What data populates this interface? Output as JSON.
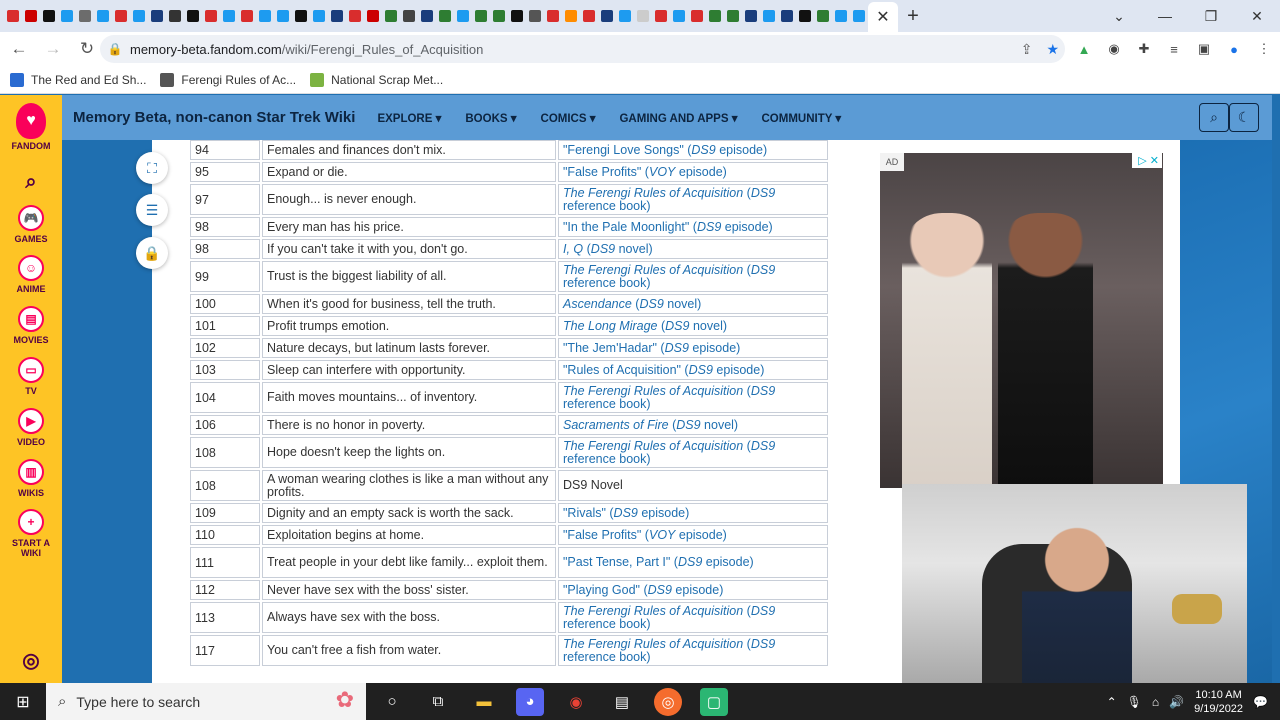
{
  "browser": {
    "tab_favicon_colors": [
      "#d92d2d",
      "#cc0000",
      "#111111",
      "#1d9bf0",
      "#6c6c6c",
      "#1d9bf0",
      "#d92d2d",
      "#1d9bf0",
      "#1a3d7c",
      "#333333",
      "#111111",
      "#d92d2d",
      "#1d9bf0",
      "#d92d2d",
      "#1d9bf0",
      "#1d9bf0",
      "#111111",
      "#1d9bf0",
      "#1a3d7c",
      "#d92d2d",
      "#cc0000",
      "#2e7d32",
      "#444444",
      "#1a3d7c",
      "#2e7d32",
      "#1d9bf0",
      "#2e7d32",
      "#2e7d32",
      "#111111",
      "#555555",
      "#d92d2d",
      "#ff8c00",
      "#d92d2d",
      "#1a3d7c",
      "#1d9bf0",
      "#cccccc",
      "#d92d2d",
      "#1d9bf0",
      "#d92d2d",
      "#2e7d32",
      "#2e7d32",
      "#1a3d7c",
      "#1d9bf0",
      "#1a3d7c",
      "#111111",
      "#2e7d32",
      "#1d9bf0",
      "#1d9bf0"
    ],
    "active_tab_close": "✕",
    "new_tab": "+",
    "url_host": "memory-beta.fandom.com",
    "url_path": "/wiki/Ferengi_Rules_of_Acquisition"
  },
  "bookmarks": [
    {
      "label": "The Red and Ed Sh...",
      "color": "#2a6bd1"
    },
    {
      "label": "Ferengi Rules of Ac...",
      "color": "#555555"
    },
    {
      "label": "National Scrap Met...",
      "color": "#7cb342"
    }
  ],
  "fandom_sidebar": {
    "brand": "FANDOM",
    "items": [
      {
        "label": "GAMES"
      },
      {
        "label": "ANIME"
      },
      {
        "label": "MOVIES"
      },
      {
        "label": "TV"
      },
      {
        "label": "VIDEO"
      },
      {
        "label": "WIKIS"
      },
      {
        "label": "START A WIKI"
      }
    ]
  },
  "wiki": {
    "title": "Memory Beta, non-canon Star Trek Wiki",
    "nav": [
      "EXPLORE ▾",
      "BOOKS ▾",
      "COMICS ▾",
      "GAMING AND APPS ▾",
      "COMMUNITY ▾"
    ]
  },
  "rules": [
    {
      "num": "94",
      "rule": "Females and finances don't mix.",
      "src": [
        {
          "t": "\"Ferengi Love Songs\" (",
          "i": false
        },
        {
          "t": "DS9",
          "i": true
        },
        {
          "t": " episode)",
          "i": false
        }
      ]
    },
    {
      "num": "95",
      "rule": "Expand or die.",
      "src": [
        {
          "t": "\"False Profits\" (",
          "i": false
        },
        {
          "t": "VOY",
          "i": true
        },
        {
          "t": " episode)",
          "i": false
        }
      ]
    },
    {
      "num": "97",
      "rule": "Enough... is never enough.",
      "tall": true,
      "src": [
        {
          "t": "The Ferengi Rules of Acquisition",
          "i": true
        },
        {
          "t": " (",
          "i": false
        },
        {
          "t": "DS9",
          "i": true
        },
        {
          "t": " reference book)",
          "i": false
        }
      ]
    },
    {
      "num": "98",
      "rule": "Every man has his price.",
      "src": [
        {
          "t": "\"In the Pale Moonlight\" (",
          "i": false
        },
        {
          "t": "DS9",
          "i": true
        },
        {
          "t": " episode)",
          "i": false
        }
      ]
    },
    {
      "num": "98",
      "rule": "If you can't take it with you, don't go.",
      "src": [
        {
          "t": "I, Q",
          "i": true
        },
        {
          "t": " (",
          "i": false
        },
        {
          "t": "DS9",
          "i": true
        },
        {
          "t": " novel)",
          "i": false
        }
      ]
    },
    {
      "num": "99",
      "rule": "Trust is the biggest liability of all.",
      "tall": true,
      "src": [
        {
          "t": "The Ferengi Rules of Acquisition",
          "i": true
        },
        {
          "t": " (",
          "i": false
        },
        {
          "t": "DS9",
          "i": true
        },
        {
          "t": " reference book)",
          "i": false
        }
      ]
    },
    {
      "num": "100",
      "rule": "When it's good for business, tell the truth.",
      "src": [
        {
          "t": "Ascendance",
          "i": true
        },
        {
          "t": " (",
          "i": false
        },
        {
          "t": "DS9",
          "i": true
        },
        {
          "t": " novel)",
          "i": false
        }
      ]
    },
    {
      "num": "101",
      "rule": "Profit trumps emotion.",
      "src": [
        {
          "t": "The Long Mirage",
          "i": true
        },
        {
          "t": " (",
          "i": false
        },
        {
          "t": "DS9",
          "i": true
        },
        {
          "t": " novel)",
          "i": false
        }
      ]
    },
    {
      "num": "102",
      "rule": "Nature decays, but latinum lasts forever.",
      "src": [
        {
          "t": "\"The Jem'Hadar\" (",
          "i": false
        },
        {
          "t": "DS9",
          "i": true
        },
        {
          "t": " episode)",
          "i": false
        }
      ]
    },
    {
      "num": "103",
      "rule": "Sleep can interfere with opportunity.",
      "src": [
        {
          "t": "\"Rules of Acquisition\" (",
          "i": false
        },
        {
          "t": "DS9",
          "i": true
        },
        {
          "t": " episode)",
          "i": false
        }
      ]
    },
    {
      "num": "104",
      "rule": "Faith moves mountains... of inventory.",
      "tall": true,
      "src": [
        {
          "t": "The Ferengi Rules of Acquisition",
          "i": true
        },
        {
          "t": " (",
          "i": false
        },
        {
          "t": "DS9",
          "i": true
        },
        {
          "t": " reference book)",
          "i": false
        }
      ]
    },
    {
      "num": "106",
      "rule": "There is no honor in poverty.",
      "src": [
        {
          "t": "Sacraments of Fire",
          "i": true
        },
        {
          "t": " (",
          "i": false
        },
        {
          "t": "DS9",
          "i": true
        },
        {
          "t": " novel)",
          "i": false
        }
      ]
    },
    {
      "num": "108",
      "rule": "Hope doesn't keep the lights on.",
      "tall": true,
      "src": [
        {
          "t": "The Ferengi Rules of Acquisition",
          "i": true
        },
        {
          "t": " (",
          "i": false
        },
        {
          "t": "DS9",
          "i": true
        },
        {
          "t": " reference book)",
          "i": false
        }
      ]
    },
    {
      "num": "108",
      "rule": "A woman wearing clothes is like a man without any profits.",
      "tall": true,
      "src": [
        {
          "t": "DS9 Novel",
          "i": false,
          "plain": true
        }
      ]
    },
    {
      "num": "109",
      "rule": "Dignity and an empty sack is worth the sack.",
      "src": [
        {
          "t": "\"Rivals\" (",
          "i": false
        },
        {
          "t": "DS9",
          "i": true
        },
        {
          "t": " episode)",
          "i": false
        }
      ]
    },
    {
      "num": "110",
      "rule": "Exploitation begins at home.",
      "src": [
        {
          "t": "\"False Profits\" (",
          "i": false
        },
        {
          "t": "VOY",
          "i": true
        },
        {
          "t": " episode)",
          "i": false
        }
      ]
    },
    {
      "num": "111",
      "rule": "Treat people in your debt like family... exploit them.",
      "tall": true,
      "src": [
        {
          "t": "\"Past Tense, Part I\" (",
          "i": false
        },
        {
          "t": "DS9",
          "i": true
        },
        {
          "t": " episode)",
          "i": false
        }
      ]
    },
    {
      "num": "112",
      "rule": "Never have sex with the boss' sister.",
      "src": [
        {
          "t": "\"Playing God\" (",
          "i": false
        },
        {
          "t": "DS9",
          "i": true
        },
        {
          "t": " episode)",
          "i": false
        }
      ]
    },
    {
      "num": "113",
      "rule": "Always have sex with the boss.",
      "tall": true,
      "src": [
        {
          "t": "The Ferengi Rules of Acquisition",
          "i": true
        },
        {
          "t": " (",
          "i": false
        },
        {
          "t": "DS9",
          "i": true
        },
        {
          "t": " reference book)",
          "i": false
        }
      ]
    },
    {
      "num": "117",
      "rule": "You can't free a fish from water.",
      "tall": true,
      "src": [
        {
          "t": "The Ferengi Rules of Acquisition",
          "i": true
        },
        {
          "t": " (",
          "i": false
        },
        {
          "t": "DS9",
          "i": true
        },
        {
          "t": " reference book)",
          "i": false
        }
      ]
    }
  ],
  "ad": {
    "tag": "AD",
    "close": "▷ ✕"
  },
  "taskbar": {
    "search_placeholder": "Type here to search",
    "time": "10:10 AM",
    "date": "9/19/2022"
  }
}
